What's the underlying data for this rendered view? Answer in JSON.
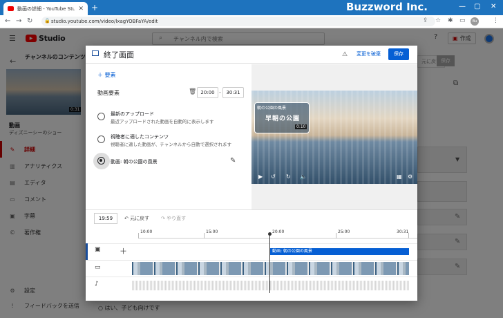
{
  "browser": {
    "tab_title": "動画の詳細 - YouTube Studio",
    "url": "studio.youtube.com/video/lxagYOBFaYA/edit",
    "brand": "Buzzword Inc.",
    "avatar_initials": "Bu"
  },
  "studio": {
    "logo": "Studio",
    "search_placeholder": "チャンネル内で検索",
    "create_label": "作成",
    "channel_title": "チャンネルのコンテンツ",
    "thumb_duration": "0:31",
    "video_label": "動画",
    "video_name": "ディズニーシーのショー",
    "nav": [
      {
        "label": "詳細",
        "icon": "pencil-icon"
      },
      {
        "label": "アナリティクス",
        "icon": "analytics-icon"
      },
      {
        "label": "エディタ",
        "icon": "editor-icon"
      },
      {
        "label": "コメント",
        "icon": "comment-icon"
      },
      {
        "label": "字幕",
        "icon": "subtitles-icon"
      },
      {
        "label": "著作権",
        "icon": "copyright-icon"
      }
    ],
    "bottom_nav": [
      {
        "label": "設定",
        "icon": "gear-icon"
      },
      {
        "label": "フィードバックを送信",
        "icon": "feedback-icon"
      }
    ],
    "bg_radio_label": "はい、子ども向けです",
    "bg_buttons": [
      "元に戻す",
      "保存"
    ]
  },
  "modal": {
    "title": "終了画面",
    "discard_label": "変更を破棄",
    "save_label": "保存",
    "add_element_label": "要素",
    "element_label": "動画要素",
    "start_time": "20:00",
    "end_time": "30:31",
    "options": [
      {
        "title": "最新のアップロード",
        "sub": "最近アップロードされた動画を自動的に表示します",
        "selected": false
      },
      {
        "title": "視聴者に適したコンテンツ",
        "sub": "視聴者に適した動画が、チャンネルから自動で選択されます",
        "selected": false
      },
      {
        "title": "動画: 朝の公園の風景",
        "sub": "",
        "selected": true
      }
    ],
    "preview": {
      "endcard_label": "朝の公園の風景",
      "endcard_title": "早朝の公園",
      "endcard_duration": "0:10"
    },
    "timeline": {
      "current_time": "19:59",
      "undo_label": "元に戻す",
      "redo_label": "やり直す",
      "ticks": [
        "10:00",
        "15:00",
        "20:00",
        "25:00",
        "30:31"
      ],
      "endcard_bar_label": "動画: 朝の公園の風景"
    }
  },
  "colors": {
    "accent": "#065fd4",
    "browser": "#1e73be",
    "active_nav": "#cc0000"
  }
}
